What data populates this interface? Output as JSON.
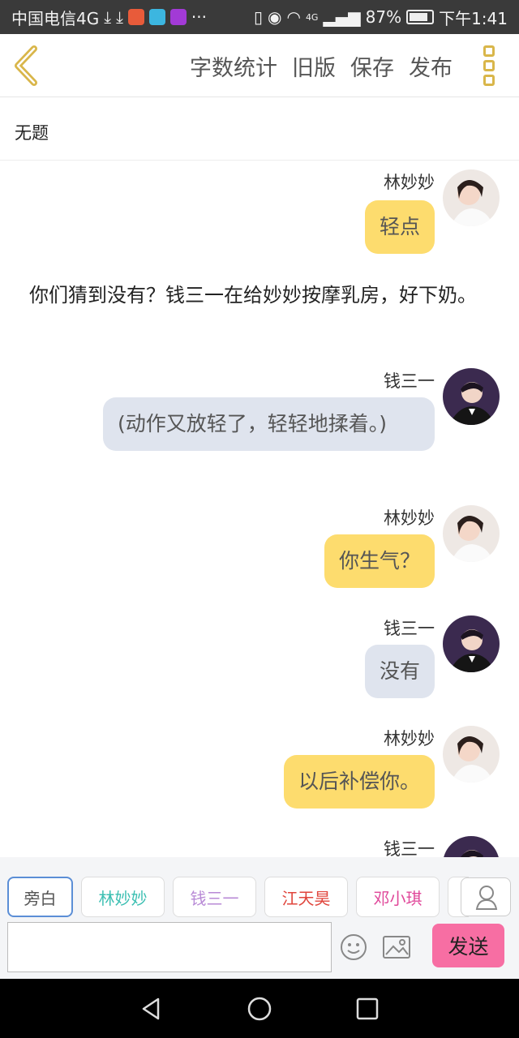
{
  "status_bar": {
    "carrier": "中国电信4G",
    "extra": "···",
    "network": "4G",
    "battery": "87%",
    "time": "下午1:41"
  },
  "header": {
    "actions": [
      "字数统计",
      "旧版",
      "保存",
      "发布"
    ],
    "accent_color": "#d9b64a"
  },
  "document": {
    "title": "无题"
  },
  "chat": {
    "messages": [
      {
        "speaker": "林妙妙",
        "text": "轻点",
        "color": "#fddc6e"
      },
      {
        "speaker": "钱三一",
        "text": "(动作又放轻了，轻轻地揉着。)",
        "color": "#dfe4ee"
      },
      {
        "speaker": "林妙妙",
        "text": "你生气？",
        "color": "#fddc6e"
      },
      {
        "speaker": "钱三一",
        "text": "没有",
        "color": "#dfe4ee"
      },
      {
        "speaker": "林妙妙",
        "text": "以后补偿你。",
        "color": "#fddc6e"
      },
      {
        "speaker": "钱三一"
      }
    ],
    "narration": "你们猜到没有？钱三一在给妙妙按摩乳房，好下奶。"
  },
  "roles": [
    {
      "label": "旁白",
      "color": "#555555"
    },
    {
      "label": "林妙妙",
      "color": "#3bbfb2"
    },
    {
      "label": "钱三一",
      "color": "#b88ad6"
    },
    {
      "label": "江天昊",
      "color": "#e0453c"
    },
    {
      "label": "邓小琪",
      "color": "#e0489a"
    }
  ],
  "composer": {
    "send_label": "发送",
    "send_color": "#f76ea3"
  }
}
